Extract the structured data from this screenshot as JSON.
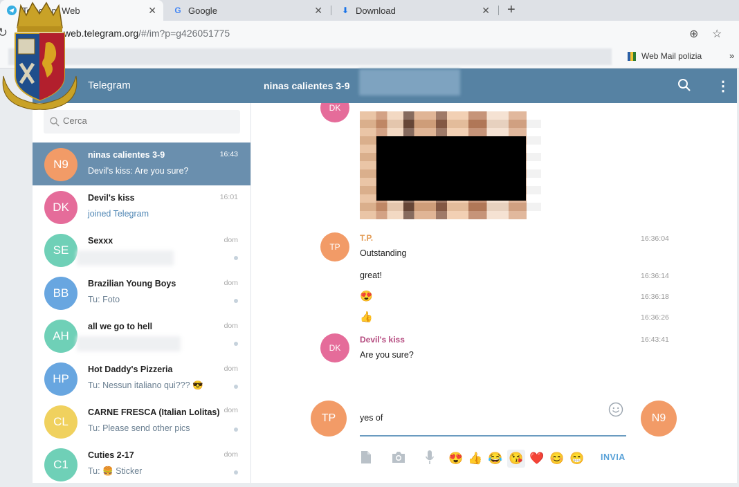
{
  "browser": {
    "tabs": [
      {
        "label": "Telegram Web",
        "icon": "telegram-icon",
        "active": true
      },
      {
        "label": "Google",
        "icon": "google-icon",
        "active": false
      },
      {
        "label": "Download",
        "icon": "download-icon",
        "active": false
      }
    ],
    "url_host": "web.telegram.org",
    "url_path": "/#/im?p=g426051775",
    "bookmark": "Web Mail polizia",
    "bookmark_more": "»"
  },
  "app": {
    "title": "Telegram",
    "chat_title": "ninas calientes 3-9",
    "search_placeholder": "Cerca",
    "accent": "#5682a3"
  },
  "dialogs": [
    {
      "initials": "N9",
      "color": "#f29b67",
      "name": "ninas calientes 3-9",
      "message": "Devil's kiss: Are you sure?",
      "time": "16:43",
      "active": true
    },
    {
      "initials": "DK",
      "color": "#e56c9a",
      "name": "Devil's kiss",
      "message": "joined Telegram",
      "time": "16:01"
    },
    {
      "initials": "SE",
      "color": "#6fd0b7",
      "name": "Sexxx",
      "message": "",
      "time": "dom"
    },
    {
      "initials": "BB",
      "color": "#68a6e0",
      "name": "Brazilian Young Boys",
      "message": "Tu: Foto",
      "time": "dom"
    },
    {
      "initials": "AH",
      "color": "#6fd0b7",
      "name": "all we go to hell",
      "message": "",
      "time": "dom"
    },
    {
      "initials": "HP",
      "color": "#68a6e0",
      "name": "Hot Daddy's Pizzeria",
      "message": "Tu: Nessun italiano qui??? 😎",
      "time": "dom"
    },
    {
      "initials": "CL",
      "color": "#f0d15e",
      "name": "CARNE FRESCA (Italian Lolitas)",
      "message": "Tu: Please send other pics",
      "time": "dom"
    },
    {
      "initials": "C1",
      "color": "#6fd0b7",
      "name": "Cuties 2-17",
      "message": "Tu: 🍔 Sticker",
      "time": "dom"
    }
  ],
  "messages": {
    "top_avatar": {
      "initials": "DK",
      "color": "#e56c9a"
    },
    "tp": {
      "initials": "TP",
      "color": "#f29b67",
      "sender": "T.P.",
      "sender_color": "#e39c56",
      "lines": [
        {
          "text": "Outstanding",
          "time": "16:36:04"
        },
        {
          "text": "great!",
          "time": "16:36:14"
        },
        {
          "text": "😍",
          "time": "16:36:18"
        },
        {
          "text": "👍",
          "time": "16:36:26"
        }
      ]
    },
    "dk": {
      "initials": "DK",
      "color": "#e56c9a",
      "sender": "Devil's kiss",
      "sender_color": "#b4497e",
      "text": "Are you sure?",
      "time": "16:43:41"
    }
  },
  "composer": {
    "value": "yes of",
    "self_avatar": {
      "initials": "TP",
      "color": "#f29b67"
    },
    "peer_avatar": {
      "initials": "N9",
      "color": "#f29b67"
    },
    "emojis": [
      "😍",
      "👍",
      "😂",
      "😘",
      "❤️",
      "😊",
      "😁"
    ],
    "send_label": "INVIA"
  }
}
